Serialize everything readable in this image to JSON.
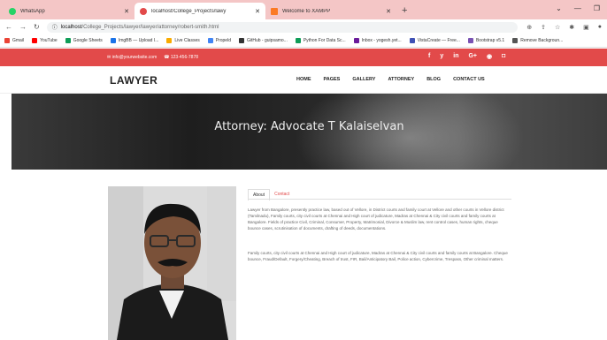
{
  "browser": {
    "tabs": [
      {
        "title": "WhatsApp",
        "color": "#25d366"
      },
      {
        "title": "localhost/College_Projects/lawy",
        "color": "#e24a4a"
      },
      {
        "title": "Welcome to XAMPP",
        "color": "#fb7a24"
      }
    ],
    "url_host": "localhost",
    "url_path": "/College_Projects/lawyer/lawyer/attorney/robert-smith.html"
  },
  "bookmarks": [
    {
      "label": "Gmail",
      "color": "#ea4335"
    },
    {
      "label": "YouTube",
      "color": "#ff0000"
    },
    {
      "label": "Google Sheets",
      "color": "#0f9d58"
    },
    {
      "label": "ImgBB — Upload I...",
      "color": "#1a73e8"
    },
    {
      "label": "Live Classes",
      "color": "#f9ab00"
    },
    {
      "label": "Propeld",
      "color": "#4285f4"
    },
    {
      "label": "GitHub - guipsamo...",
      "color": "#333"
    },
    {
      "label": "Python For Data Sc...",
      "color": "#0f9d58"
    },
    {
      "label": "Inbox - yogesh.yet...",
      "color": "#6a1b9a"
    },
    {
      "label": "VistaCreate — Free...",
      "color": "#3f51b5"
    },
    {
      "label": "Bootstrap v5.1",
      "color": "#7952b3"
    },
    {
      "label": "Remove Backgroun...",
      "color": "#555"
    }
  ],
  "topbar": {
    "email": "info@yourwebsite.com",
    "phone": "123-456-7878",
    "social": [
      "f",
      "y",
      "in",
      "G+",
      "◉",
      "◘"
    ]
  },
  "site": {
    "logo": "LAWYER",
    "menu": [
      "HOME",
      "PAGES",
      "GALLERY",
      "ATTORNEY",
      "BLOG",
      "CONTACT US"
    ]
  },
  "hero": {
    "title": "Attorney: Advocate T Kalaiselvan"
  },
  "profile": {
    "tabs": [
      "About",
      "Contact"
    ],
    "para1": "Lawyer from Bangalore, presently practice law, based out of Vellore, in District courts and family court at Vellore and other courts in Vellore district (Tamilnadu), Family courts, city civil courts at Chennai and High court of judicature, Madras at Chennai & City civil courts and family courts at Bangalore. Fields of practice Civil, Criminal, Consumer, Property, Matrimonial, Divorce & Muslim law, rent control cases, human rights, cheque bounce cases, scrutinisation of documents, drafting of deeds, documentations.",
    "para2": "Family courts, city civil courts at Chennai and High court of judicature, Madras at Chennai & City civil courts and family courts at Bangalore. Cheque bounce, Fraud/Default, Forgery/Cheating, Breach of trust, FIR, Bail/Anticipatory Bail, Police action, Cybercrime, Trespass, Other criminal matters."
  }
}
